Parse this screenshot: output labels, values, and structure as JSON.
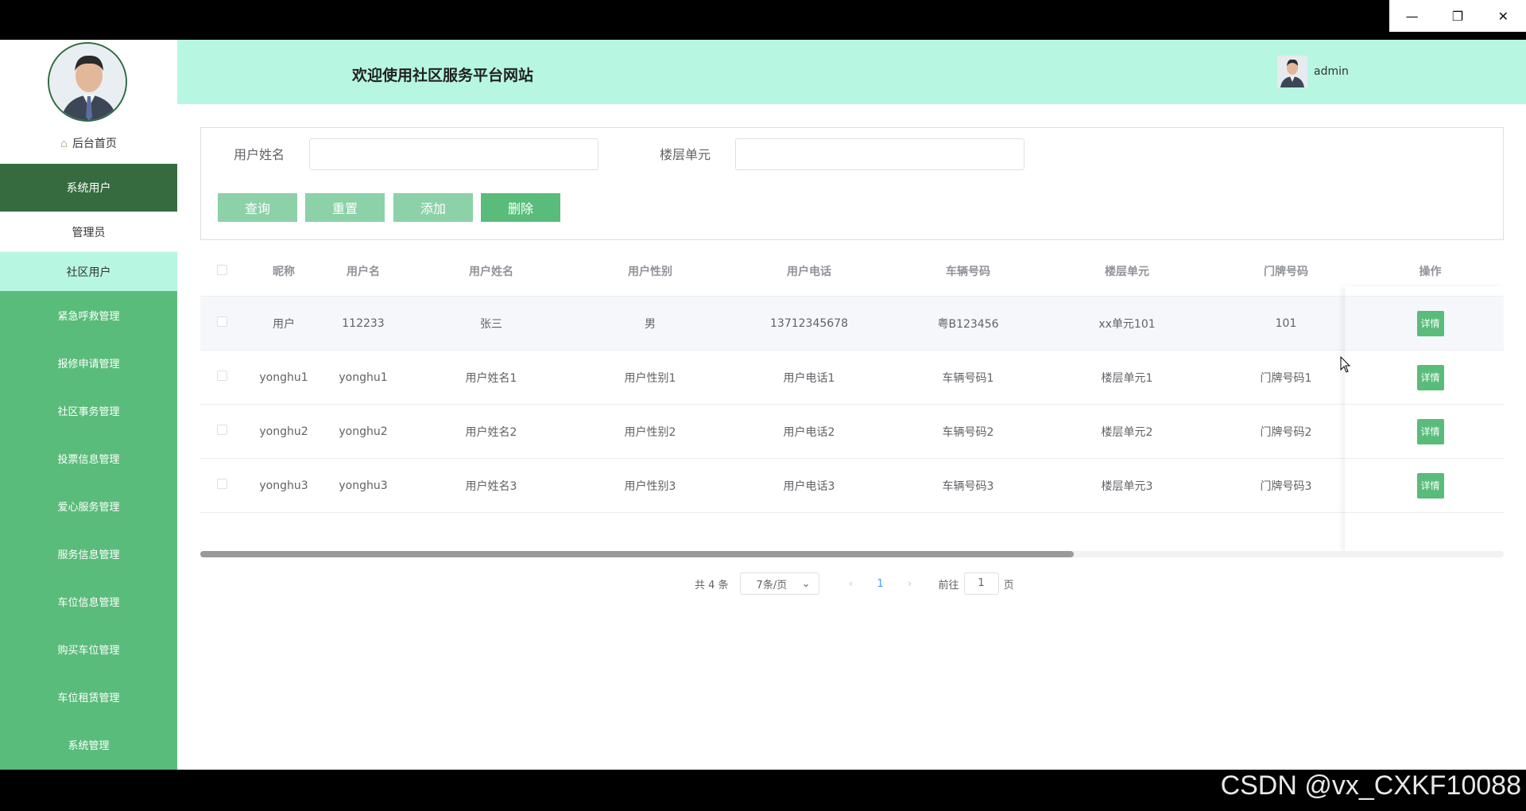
{
  "window": {
    "minimize": "—",
    "restore": "❐",
    "close": "✕"
  },
  "sidebar": {
    "home": "后台首页",
    "group": "系统用户",
    "sub_items": [
      "管理员",
      "社区用户"
    ],
    "items": [
      "紧急呼救管理",
      "报修申请管理",
      "社区事务管理",
      "投票信息管理",
      "爱心服务管理",
      "服务信息管理",
      "车位信息管理",
      "购买车位管理",
      "车位租赁管理",
      "系统管理"
    ]
  },
  "header": {
    "title": "欢迎使用社区服务平台网站",
    "user": "admin"
  },
  "search": {
    "field1_label": "用户姓名",
    "field1_value": "",
    "field2_label": "楼层单元",
    "field2_value": "",
    "btn_query": "查询",
    "btn_reset": "重置",
    "btn_add": "添加",
    "btn_delete": "删除"
  },
  "table": {
    "columns": [
      "昵称",
      "用户名",
      "用户姓名",
      "用户性别",
      "用户电话",
      "车辆号码",
      "楼层单元",
      "门牌号码",
      "操作"
    ],
    "rows": [
      [
        "用户",
        "112233",
        "张三",
        "男",
        "13712345678",
        "粤B123456",
        "xx单元101",
        "101"
      ],
      [
        "yonghu1",
        "yonghu1",
        "用户姓名1",
        "用户性别1",
        "用户电话1",
        "车辆号码1",
        "楼层单元1",
        "门牌号码1"
      ],
      [
        "yonghu2",
        "yonghu2",
        "用户姓名2",
        "用户性别2",
        "用户电话2",
        "车辆号码2",
        "楼层单元2",
        "门牌号码2"
      ],
      [
        "yonghu3",
        "yonghu3",
        "用户姓名3",
        "用户性别3",
        "用户电话3",
        "车辆号码3",
        "楼层单元3",
        "门牌号码3"
      ]
    ],
    "detail_label": "详情",
    "horizontal_scroll_fraction": 0.67
  },
  "pagination": {
    "total": "共 4 条",
    "page_size": "7条/页",
    "current_page": "1",
    "goto_label": "前往",
    "goto_value": "1",
    "page_suffix": "页"
  },
  "watermark": "CSDN @vx_CXKF10088",
  "colors": {
    "primary": "#5abc7b",
    "dark_green": "#356b3f",
    "mint": "#b7f7e2",
    "light_btn": "#8cd1a8"
  }
}
